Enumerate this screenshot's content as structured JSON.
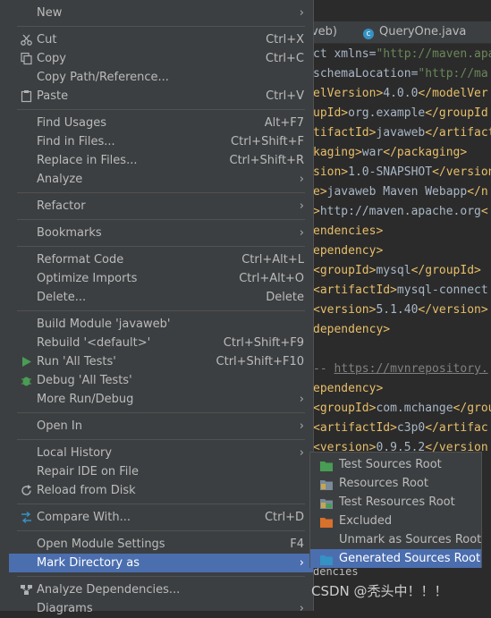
{
  "tabs": [
    {
      "label": "aveb)"
    },
    {
      "label": "QueryOne.java",
      "icon": "class-c-icon"
    }
  ],
  "code_lines": [
    {
      "p": [
        [
          "t",
          "ct xmlns="
        ],
        [
          "s",
          "\"http://maven.apa"
        ]
      ]
    },
    {
      "p": [
        [
          "t",
          "schemaLocation="
        ],
        [
          "s",
          "\"http://ma"
        ]
      ]
    },
    {
      "p": [
        [
          "",
          "elVersion>"
        ],
        [
          "t",
          "4.0.0"
        ],
        [
          "",
          "</modelVer"
        ]
      ]
    },
    {
      "p": [
        [
          "",
          "upId>"
        ],
        [
          "t",
          "org.example"
        ],
        [
          "",
          "</groupId"
        ]
      ]
    },
    {
      "p": [
        [
          "",
          "tifactId>"
        ],
        [
          "t",
          "javaweb"
        ],
        [
          "",
          "</artifact"
        ]
      ]
    },
    {
      "p": [
        [
          "",
          "kaging>"
        ],
        [
          "t",
          "war"
        ],
        [
          "",
          "</packaging>"
        ]
      ]
    },
    {
      "p": [
        [
          "",
          "sion>"
        ],
        [
          "t",
          "1.0-SNAPSHOT"
        ],
        [
          "",
          "</version"
        ]
      ]
    },
    {
      "p": [
        [
          "",
          "e>"
        ],
        [
          "t",
          "javaweb Maven Webapp"
        ],
        [
          "",
          "</n"
        ]
      ]
    },
    {
      "p": [
        [
          "",
          ">"
        ],
        [
          "t",
          "http://maven.apache.org"
        ],
        [
          "",
          "<"
        ]
      ]
    },
    {
      "p": [
        [
          "",
          "endencies>"
        ]
      ]
    },
    {
      "p": [
        [
          "",
          "ependency>"
        ]
      ]
    },
    {
      "p": [
        [
          "",
          "<groupId>"
        ],
        [
          "t",
          "mysql"
        ],
        [
          "",
          "</groupId>"
        ]
      ]
    },
    {
      "p": [
        [
          "",
          "<artifactId>"
        ],
        [
          "t",
          "mysql-connect"
        ]
      ]
    },
    {
      "p": [
        [
          "",
          "<version>"
        ],
        [
          "t",
          "5.1.40"
        ],
        [
          "",
          "</version>"
        ]
      ]
    },
    {
      "p": [
        [
          "",
          "dependency>"
        ]
      ]
    },
    {
      "p": []
    },
    {
      "p": [
        [
          "c",
          "-- "
        ],
        [
          "u",
          "https://mvnrepository."
        ]
      ]
    },
    {
      "p": [
        [
          "",
          "ependency>"
        ]
      ]
    },
    {
      "p": [
        [
          "",
          "<groupId>"
        ],
        [
          "t",
          "com.mchange"
        ],
        [
          "",
          "</group"
        ]
      ]
    },
    {
      "p": [
        [
          "",
          "<artifactId>"
        ],
        [
          "t",
          "c3p0"
        ],
        [
          "",
          "</artifac"
        ]
      ]
    },
    {
      "p": [
        [
          "",
          "<version>"
        ],
        [
          "t",
          "0.9.5.2"
        ],
        [
          "",
          "</version"
        ]
      ]
    }
  ],
  "menu": {
    "items": [
      {
        "label": "New",
        "arrow": true
      },
      {
        "sep": true
      },
      {
        "label": "Cut",
        "shortcut": "Ctrl+X",
        "icon": "scissors-icon"
      },
      {
        "label": "Copy",
        "shortcut": "Ctrl+C",
        "icon": "copy-icon"
      },
      {
        "label": "Copy Path/Reference..."
      },
      {
        "label": "Paste",
        "shortcut": "Ctrl+V",
        "icon": "clipboard-icon"
      },
      {
        "sep": true
      },
      {
        "label": "Find Usages",
        "shortcut": "Alt+F7"
      },
      {
        "label": "Find in Files...",
        "shortcut": "Ctrl+Shift+F"
      },
      {
        "label": "Replace in Files...",
        "shortcut": "Ctrl+Shift+R"
      },
      {
        "label": "Analyze",
        "arrow": true
      },
      {
        "sep": true
      },
      {
        "label": "Refactor",
        "arrow": true
      },
      {
        "sep": true
      },
      {
        "label": "Bookmarks",
        "arrow": true
      },
      {
        "sep": true
      },
      {
        "label": "Reformat Code",
        "shortcut": "Ctrl+Alt+L"
      },
      {
        "label": "Optimize Imports",
        "shortcut": "Ctrl+Alt+O"
      },
      {
        "label": "Delete...",
        "shortcut": "Delete"
      },
      {
        "sep": true
      },
      {
        "label": "Build Module 'javaweb'"
      },
      {
        "label": "Rebuild '<default>'",
        "shortcut": "Ctrl+Shift+F9"
      },
      {
        "label": "Run 'All Tests'",
        "shortcut": "Ctrl+Shift+F10",
        "icon": "run-icon"
      },
      {
        "label": "Debug 'All Tests'",
        "icon": "debug-icon"
      },
      {
        "label": "More Run/Debug",
        "arrow": true
      },
      {
        "sep": true
      },
      {
        "label": "Open In",
        "arrow": true
      },
      {
        "sep": true
      },
      {
        "label": "Local History",
        "arrow": true
      },
      {
        "label": "Repair IDE on File"
      },
      {
        "label": "Reload from Disk",
        "icon": "reload-icon"
      },
      {
        "sep": true
      },
      {
        "label": "Compare With...",
        "shortcut": "Ctrl+D",
        "icon": "compare-icon"
      },
      {
        "sep": true
      },
      {
        "label": "Open Module Settings",
        "shortcut": "F4"
      },
      {
        "label": "Mark Directory as",
        "arrow": true,
        "selected": true
      },
      {
        "sep": true
      },
      {
        "label": "Analyze Dependencies...",
        "icon": "dependencies-icon"
      },
      {
        "label": "Diagrams",
        "arrow": true
      }
    ]
  },
  "submenu": {
    "items": [
      {
        "label": "Test Sources Root",
        "icon": "test-sources-folder-icon",
        "color": "#499c54"
      },
      {
        "label": "Resources Root",
        "icon": "resources-folder-icon",
        "color": "#7a8a99"
      },
      {
        "label": "Test Resources Root",
        "icon": "test-resources-folder-icon",
        "color": "#7a8a99"
      },
      {
        "label": "Excluded",
        "icon": "excluded-folder-icon",
        "color": "#d9702c"
      },
      {
        "label": "Unmark as Sources Root",
        "icon": ""
      },
      {
        "label": "Generated Sources Root",
        "icon": "generated-sources-folder-icon",
        "color": "#3592c4",
        "selected": true
      }
    ]
  },
  "bottom_text": "dencies",
  "watermark": "CSDN @秃头中！！！"
}
